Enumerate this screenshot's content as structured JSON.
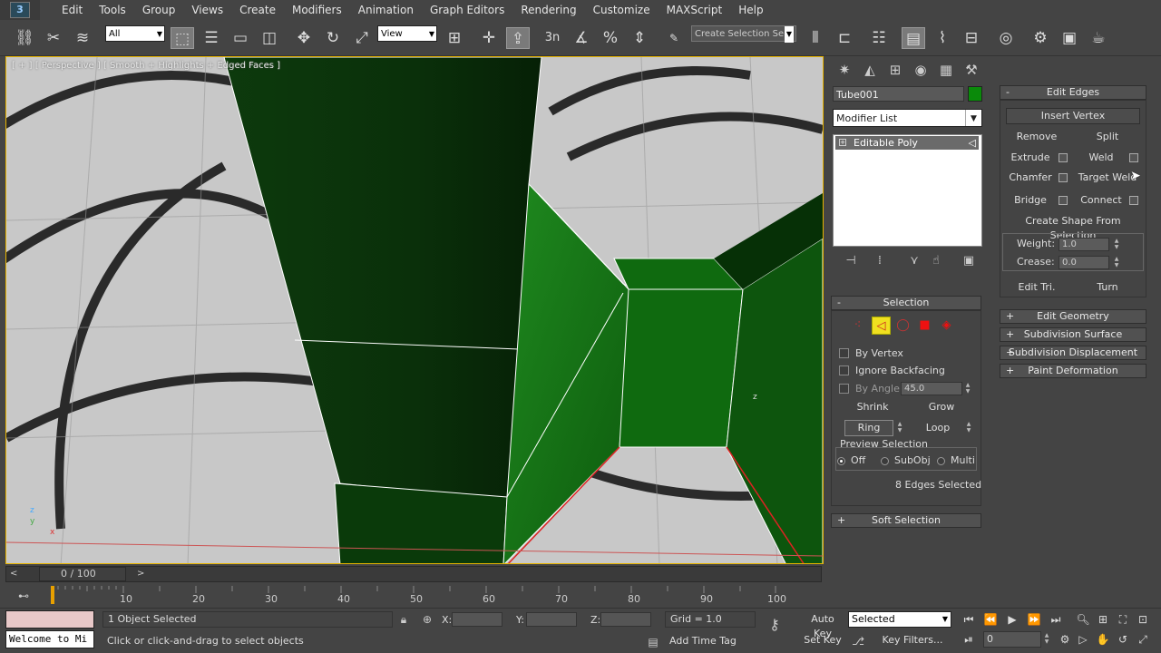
{
  "app": {
    "logo_text": "3"
  },
  "menubar": {
    "items": [
      "Edit",
      "Tools",
      "Group",
      "Views",
      "Create",
      "Modifiers",
      "Animation",
      "Graph Editors",
      "Rendering",
      "Customize",
      "MAXScript",
      "Help"
    ]
  },
  "toolbar": {
    "filter_value": "All",
    "coord_value": "View",
    "snap_text": "3n",
    "selection_set_placeholder": "Create Selection Se"
  },
  "viewport": {
    "label": "[ + ] [ Perspective ] [ Smooth + Highlights + Edged Faces ]",
    "axis_z": "z",
    "axis_x": "x",
    "axis_y": "y",
    "gizmo_label": "z"
  },
  "command_panel": {
    "object_name": "Tube001",
    "object_color": "#0a8a0a",
    "modifier_list": "Modifier List",
    "stack_items": [
      "Editable Poly"
    ]
  },
  "selection": {
    "title": "Selection",
    "by_vertex": "By Vertex",
    "ignore_backfacing": "Ignore Backfacing",
    "by_angle": "By Angle:",
    "by_angle_value": "45.0",
    "shrink": "Shrink",
    "grow": "Grow",
    "ring": "Ring",
    "loop": "Loop",
    "preview_title": "Preview Selection",
    "preview_off": "Off",
    "preview_subobj": "SubObj",
    "preview_multi": "Multi",
    "status": "8 Edges Selected"
  },
  "soft_selection": {
    "title": "Soft Selection"
  },
  "edit_edges": {
    "title": "Edit Edges",
    "insert_vertex": "Insert Vertex",
    "remove": "Remove",
    "split": "Split",
    "extrude": "Extrude",
    "weld": "Weld",
    "chamfer": "Chamfer",
    "target_weld": "Target Weld",
    "bridge": "Bridge",
    "connect": "Connect",
    "create_shape": "Create Shape From Selection",
    "weight_label": "Weight:",
    "weight_value": "1.0",
    "crease_label": "Crease:",
    "crease_value": "0.0",
    "edit_tri": "Edit Tri.",
    "turn": "Turn"
  },
  "collapsed_rollouts": [
    "Edit Geometry",
    "Subdivision Surface",
    "Subdivision Displacement",
    "Paint Deformation"
  ],
  "timeline": {
    "frame_label": "0 / 100",
    "ticks": [
      "10",
      "20",
      "30",
      "40",
      "50",
      "60",
      "70",
      "80",
      "90",
      "100"
    ]
  },
  "status": {
    "selected": "1 Object Selected",
    "prompt": "Click or click-and-drag to select objects",
    "maxscript_text": "Welcome to Mi",
    "x_label": "X:",
    "y_label": "Y:",
    "z_label": "Z:",
    "grid": "Grid = 1.0",
    "add_time_tag": "Add Time Tag",
    "auto_key": "Auto Key",
    "set_key": "Set Key",
    "key_mode": "Selected",
    "key_filters": "Key Filters...",
    "current_frame": "0"
  }
}
